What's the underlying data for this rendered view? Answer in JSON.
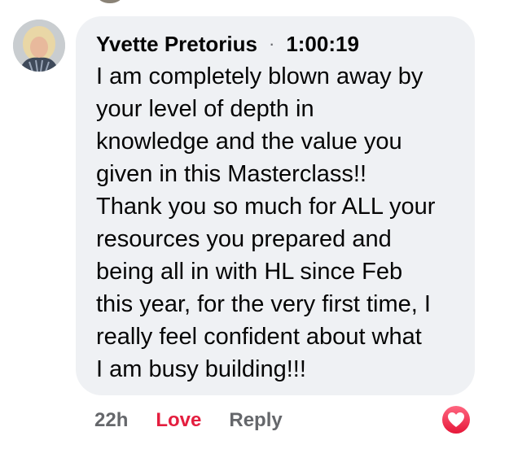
{
  "comment": {
    "author": "Yvette Pretorius",
    "separator": "·",
    "timestamp": "1:00:19",
    "text_lines": [
      "I am completely blown away by",
      "your level of depth in",
      "knowledge and the value you",
      "given in this Masterclass!!",
      "Thank you so much for ALL your",
      "resources you prepared and",
      "being all in with HL since Feb",
      "this year, for the very first time, I",
      "really feel confident about what",
      "I am busy building!!!"
    ]
  },
  "actions": {
    "age": "22h",
    "love_label": "Love",
    "reply_label": "Reply"
  },
  "reaction": {
    "icon": "heart-icon",
    "color": "#f02849"
  },
  "colors": {
    "bubble_bg": "#eff1f4",
    "love_red": "#e41e3f",
    "muted_gray": "#65676b"
  }
}
